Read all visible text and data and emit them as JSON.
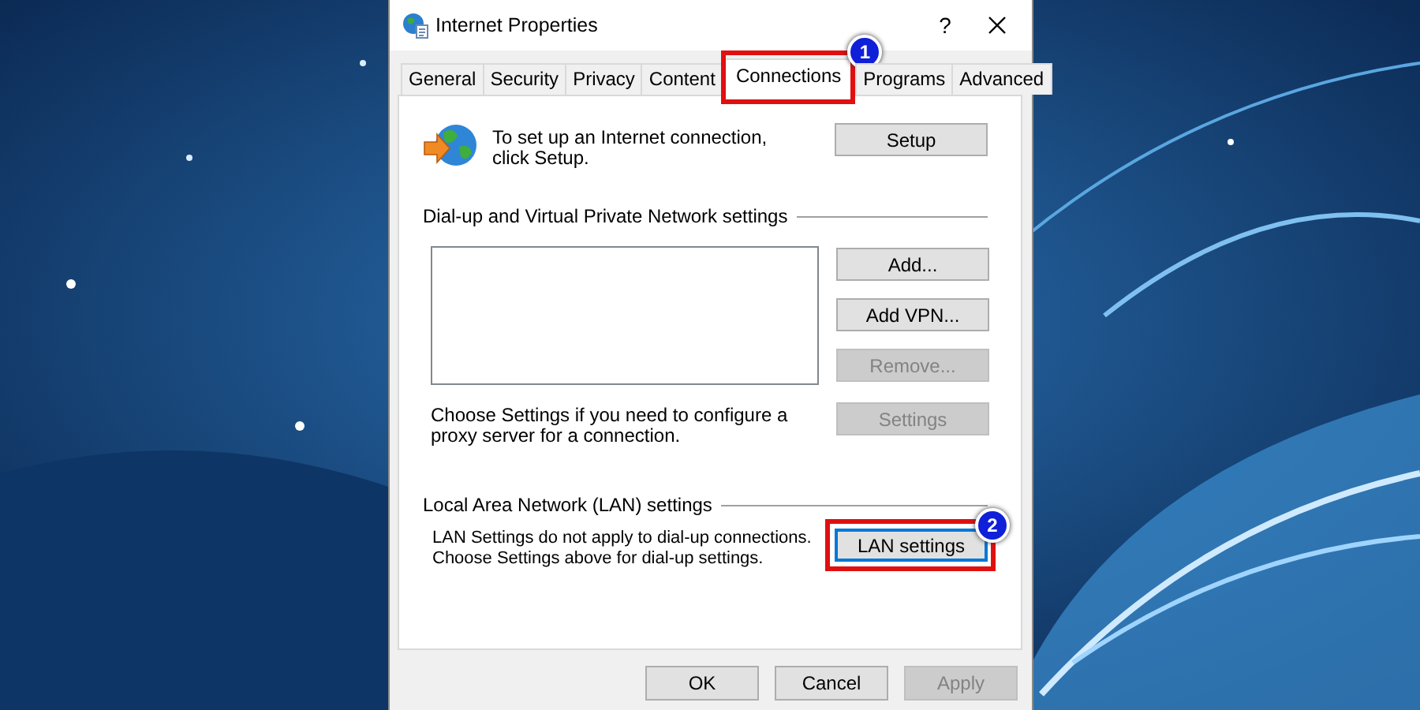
{
  "window": {
    "title": "Internet Properties",
    "help_button": "?"
  },
  "tabs": [
    {
      "label": "General",
      "selected": false
    },
    {
      "label": "Security",
      "selected": false
    },
    {
      "label": "Privacy",
      "selected": false
    },
    {
      "label": "Content",
      "selected": false
    },
    {
      "label": "Connections",
      "selected": true,
      "callout": "1"
    },
    {
      "label": "Programs",
      "selected": false
    },
    {
      "label": "Advanced",
      "selected": false
    }
  ],
  "setup": {
    "text": "To set up an Internet connection, click Setup.",
    "button": {
      "label": "Setup",
      "disabled": false
    }
  },
  "dialup": {
    "heading": "Dial-up and Virtual Private Network settings",
    "buttons": [
      {
        "label": "Add...",
        "disabled": false
      },
      {
        "label": "Add VPN...",
        "disabled": false
      },
      {
        "label": "Remove...",
        "disabled": true
      }
    ],
    "note": "Choose Settings if you need to configure a proxy server for a connection.",
    "settings_button": {
      "label": "Settings",
      "disabled": true
    }
  },
  "lan": {
    "heading": "Local Area Network (LAN) settings",
    "text": "LAN Settings do not apply to dial-up connections. Choose Settings above for dial-up settings.",
    "button": {
      "label": "LAN settings",
      "disabled": false,
      "focused": true,
      "callout": "2"
    }
  },
  "footer_buttons": [
    {
      "label": "OK",
      "disabled": false
    },
    {
      "label": "Cancel",
      "disabled": false
    },
    {
      "label": "Apply",
      "disabled": true
    }
  ]
}
